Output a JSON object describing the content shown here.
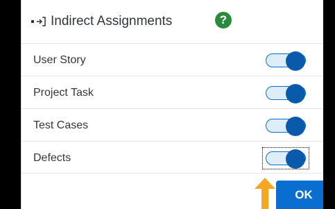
{
  "header": {
    "collapse_icon": "collapse-arrow-icon",
    "title": "Indirect Assignments",
    "help_icon": "help-icon",
    "help_glyph": "?"
  },
  "rows": [
    {
      "label": "User Story",
      "enabled": true
    },
    {
      "label": "Project Task",
      "enabled": true
    },
    {
      "label": "Test Cases",
      "enabled": true
    },
    {
      "label": "Defects",
      "enabled": true,
      "focused": true
    }
  ],
  "footer": {
    "ok_label": "OK"
  },
  "annotation": {
    "pointer_icon": "pointer-arrow-icon",
    "color": "#f5a623"
  },
  "colors": {
    "switch_knob": "#0a5aab",
    "switch_track": "#ddeefa",
    "ok_button": "#0a6ed1",
    "help": "#2b8a3e"
  }
}
